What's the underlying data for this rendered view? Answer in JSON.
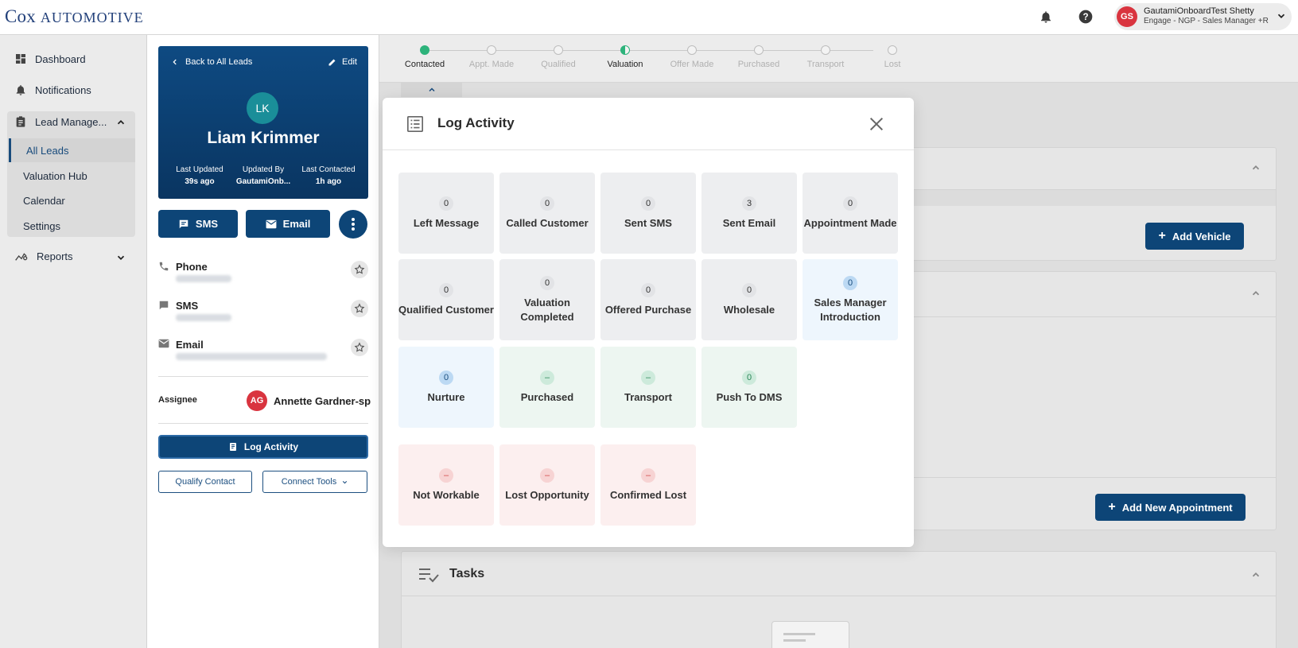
{
  "brand": {
    "logo_main": "Cox ",
    "logo_second": "Automotive"
  },
  "user": {
    "initials": "GS",
    "name": "GautamiOnboardTest Shetty",
    "role": "Engage - NGP - Sales Manager +R"
  },
  "nav": {
    "dashboard": "Dashboard",
    "notifications": "Notifications",
    "lead_management": "Lead Manage...",
    "sub": [
      "All Leads",
      "Valuation Hub",
      "Calendar",
      "Settings"
    ],
    "reports": "Reports"
  },
  "lead": {
    "back": "Back to All Leads",
    "edit": "Edit",
    "initials": "LK",
    "name": "Liam Krimmer",
    "meta": [
      {
        "label": "Last Updated",
        "value": "39s ago"
      },
      {
        "label": "Updated By",
        "value": "GautamiOnb..."
      },
      {
        "label": "Last Contacted",
        "value": "1h ago"
      }
    ],
    "sms_btn": "SMS",
    "email_btn": "Email",
    "phone_label": "Phone",
    "sms_label": "SMS",
    "email_label": "Email",
    "assignee_label": "Assignee",
    "assignee_initials": "AG",
    "assignee_name": "Annette Gardner-sp",
    "log_activity_btn": "Log Activity",
    "qualify_btn": "Qualify Contact",
    "connect_btn": "Connect Tools"
  },
  "stepper": {
    "steps": [
      "Contacted",
      "Appt. Made",
      "Qualified",
      "Valuation",
      "Offer Made",
      "Purchased",
      "Transport",
      "Lost"
    ],
    "completed_index": 0,
    "current_index": 3
  },
  "main": {
    "add_vehicle": "Add Vehicle",
    "add_appointment": "Add New Appointment",
    "tasks_title": "Tasks"
  },
  "modal": {
    "title": "Log Activity",
    "tiles": [
      {
        "label": "Left Message",
        "count": "0",
        "kind": "gray"
      },
      {
        "label": "Called Customer",
        "count": "0",
        "kind": "gray"
      },
      {
        "label": "Sent SMS",
        "count": "0",
        "kind": "gray"
      },
      {
        "label": "Sent Email",
        "count": "3",
        "kind": "gray"
      },
      {
        "label": "Appointment Made",
        "count": "0",
        "kind": "gray"
      },
      {
        "label": "Qualified Customer",
        "count": "0",
        "kind": "gray"
      },
      {
        "label": "Valuation Completed",
        "count": "0",
        "kind": "gray"
      },
      {
        "label": "Offered Purchase",
        "count": "0",
        "kind": "gray"
      },
      {
        "label": "Wholesale",
        "count": "0",
        "kind": "gray"
      },
      {
        "label": "Sales Manager Introduction",
        "count": "0",
        "kind": "blue"
      },
      {
        "label": "Nurture",
        "count": "0",
        "kind": "blue"
      },
      {
        "label": "Purchased",
        "count": "–",
        "kind": "green"
      },
      {
        "label": "Transport",
        "count": "–",
        "kind": "green"
      },
      {
        "label": "Push To DMS",
        "count": "0",
        "kind": "green"
      },
      {
        "label": "Not Workable",
        "count": "–",
        "kind": "red"
      },
      {
        "label": "Lost Opportunity",
        "count": "–",
        "kind": "red"
      },
      {
        "label": "Confirmed Lost",
        "count": "–",
        "kind": "red"
      }
    ]
  },
  "colors": {
    "primary": "#0d4577",
    "step_done": "#2db37b",
    "avatar_red": "#d9343f",
    "teal": "#1a8e99"
  }
}
